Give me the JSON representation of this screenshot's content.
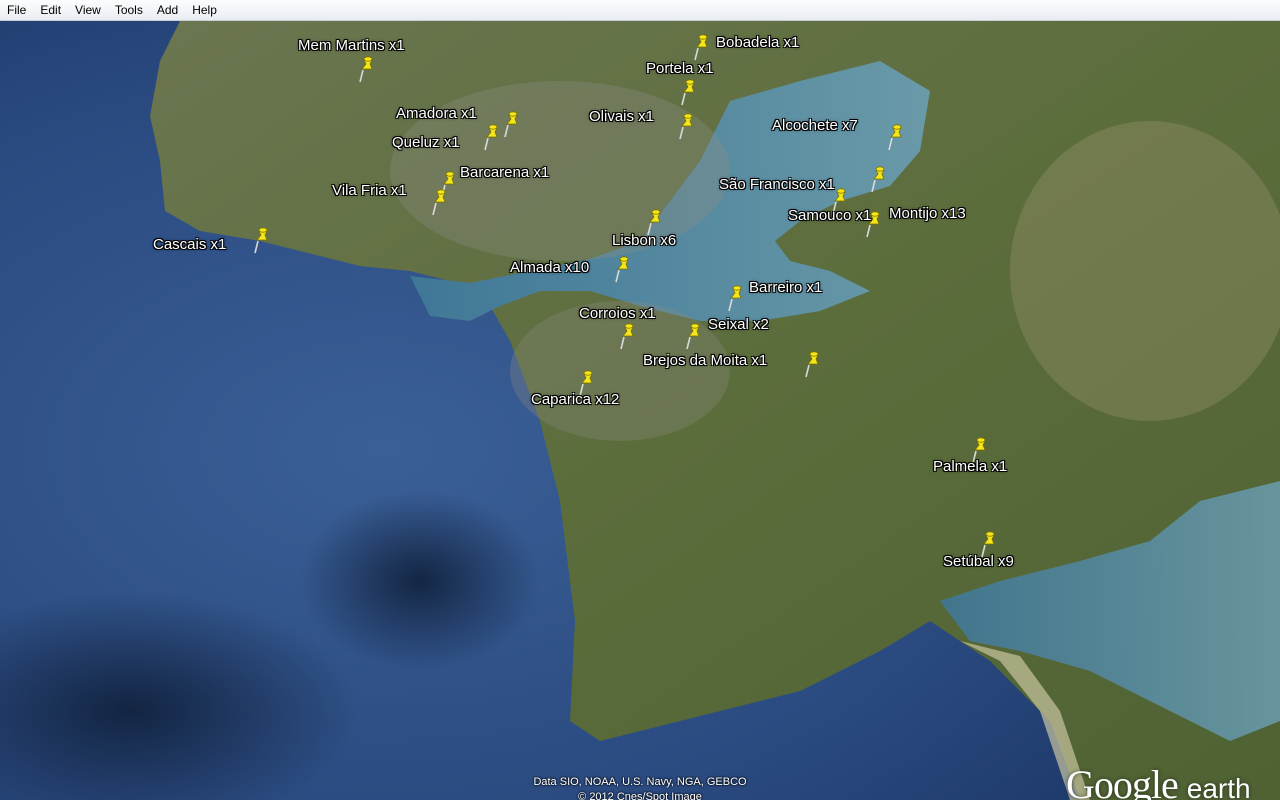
{
  "menu": [
    "File",
    "Edit",
    "View",
    "Tools",
    "Add",
    "Help"
  ],
  "placemarks": [
    {
      "id": "mem-martins",
      "label": "Mem Martins x1"
    },
    {
      "id": "bobadela",
      "label": "Bobadela x1"
    },
    {
      "id": "portela",
      "label": "Portela x1"
    },
    {
      "id": "amadora",
      "label": "Amadora x1"
    },
    {
      "id": "olivais",
      "label": "Olivais x1"
    },
    {
      "id": "queluz",
      "label": "Queluz x1"
    },
    {
      "id": "alcochete",
      "label": "Alcochete x7"
    },
    {
      "id": "barcarena",
      "label": "Barcarena x1"
    },
    {
      "id": "vila-fria",
      "label": "Vila Fria x1"
    },
    {
      "id": "sao-francisco",
      "label": "São Francisco x1"
    },
    {
      "id": "samouco",
      "label": "Samouco x1"
    },
    {
      "id": "montijo",
      "label": "Montijo x13"
    },
    {
      "id": "cascais",
      "label": "Cascais x1"
    },
    {
      "id": "lisbon",
      "label": "Lisbon x6"
    },
    {
      "id": "almada",
      "label": "Almada x10"
    },
    {
      "id": "barreiro",
      "label": "Barreiro x1"
    },
    {
      "id": "corroios",
      "label": "Corroios x1"
    },
    {
      "id": "seixal",
      "label": "Seixal x2"
    },
    {
      "id": "brejos-da-moita",
      "label": "Brejos da Moita x1"
    },
    {
      "id": "caparica",
      "label": "Caparica x12"
    },
    {
      "id": "palmela",
      "label": "Palmela x1"
    },
    {
      "id": "setubal",
      "label": "Setúbal x9"
    }
  ],
  "credits": [
    "Data SIO, NOAA, U.S. Navy, NGA, GEBCO",
    "© 2012 Cnes/Spot Image"
  ],
  "logo": {
    "google": "Google",
    "earth": "earth"
  },
  "colors": {
    "pin": "#f4e61a",
    "ocean": "#2c4f86",
    "land": "#5a6b3a",
    "river": "#4e86a0"
  }
}
